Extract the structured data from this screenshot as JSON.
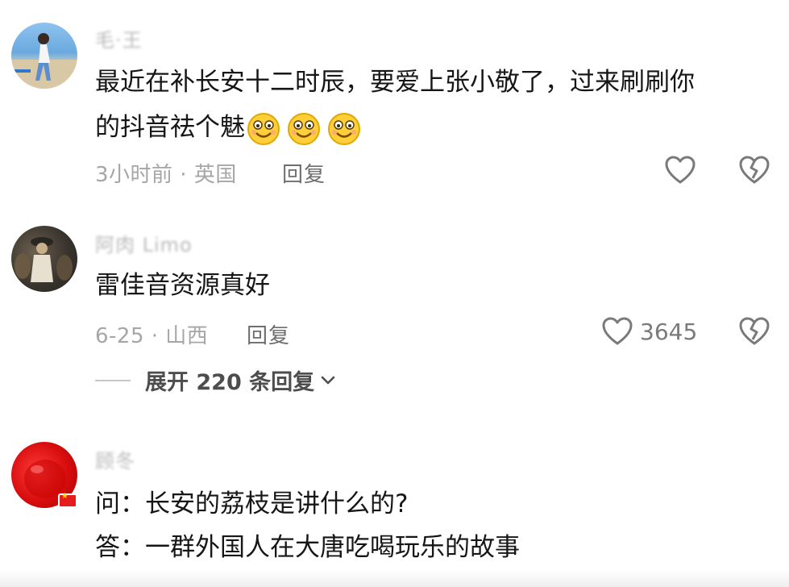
{
  "comments": [
    {
      "username": "毛·王",
      "text_line1": "最近在补长安十二时辰，要爱上张小敬了，过来刷刷你",
      "text_line2": "的抖音祛个魅",
      "meta": "3小时前 · 英国",
      "reply_label": "回复",
      "like_count": "",
      "emoji_count": 3
    },
    {
      "username": "阿肉 Limo",
      "text_line1": "雷佳音资源真好",
      "meta": "6-25 · 山西",
      "reply_label": "回复",
      "like_count": "3645"
    },
    {
      "username": "顾冬",
      "text_line1": "问：长安的荔枝是讲什么的?",
      "text_line2": "答：一群外国人在大唐吃喝玩乐的故事"
    }
  ],
  "expand_replies": {
    "label": "展开 220 条回复"
  },
  "icons": {
    "like": "heart-icon",
    "dislike": "broken-heart-icon",
    "expand": "chevron-down-icon",
    "emoji": "smile-emoji-icon"
  },
  "colors": {
    "text": "#161616",
    "meta": "#a6a6a6",
    "icon": "#7a7a7a"
  }
}
